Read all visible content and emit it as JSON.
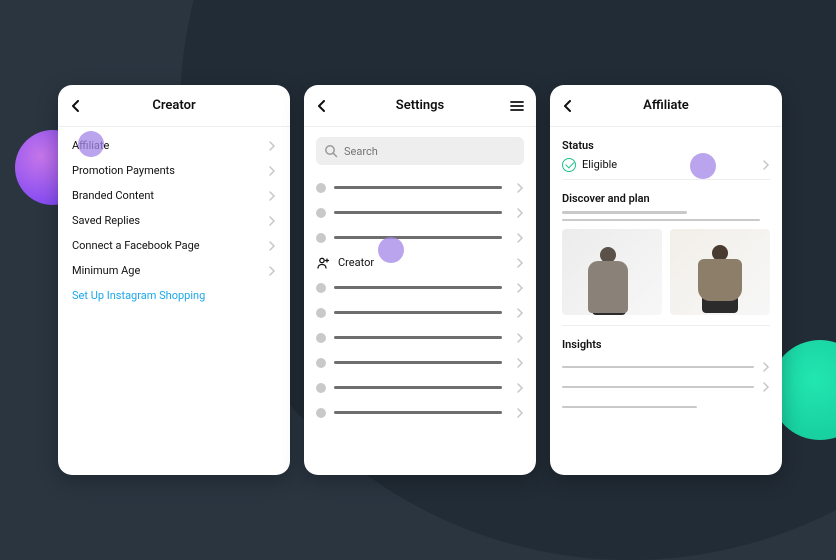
{
  "colors": {
    "accent_link": "#1ba7ea",
    "highlight": "#a386e7",
    "status_ok": "#1fc28a"
  },
  "panels": {
    "creator": {
      "title": "Creator",
      "items": [
        {
          "label": "Affiliate"
        },
        {
          "label": "Promotion Payments"
        },
        {
          "label": "Branded Content"
        },
        {
          "label": "Saved Replies"
        },
        {
          "label": "Connect a Facebook Page"
        },
        {
          "label": "Minimum Age"
        }
      ],
      "link_label": "Set Up Instagram Shopping"
    },
    "settings": {
      "title": "Settings",
      "search_placeholder": "Search",
      "named_row_label": "Creator"
    },
    "affiliate": {
      "title": "Affiliate",
      "status_label": "Status",
      "status_value": "Eligible",
      "discover_label": "Discover and plan",
      "insights_label": "Insights"
    }
  }
}
